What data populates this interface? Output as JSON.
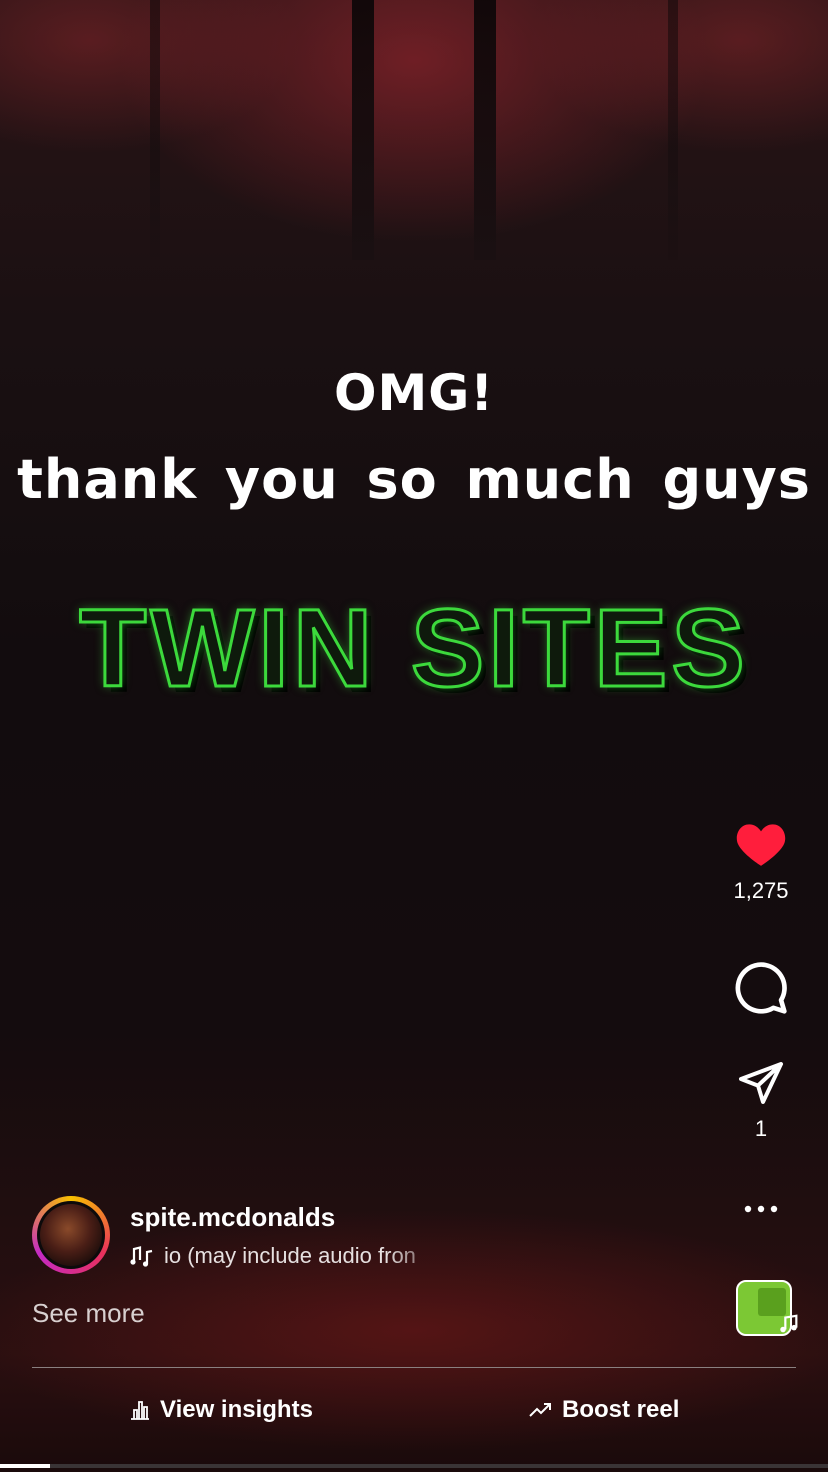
{
  "caption": {
    "line1": "OMG!",
    "line2": "thank you so much guys"
  },
  "title_graphic": "TWIN SITES",
  "actions": {
    "like_count": "1,275",
    "share_count": "1"
  },
  "author": {
    "username": "spite.mcdonalds",
    "audio_text": "io  (may include audio fron"
  },
  "see_more_label": "See more",
  "footer": {
    "insights_label": "View insights",
    "boost_label": "Boost reel"
  },
  "colors": {
    "like_red": "#ff1e3c",
    "title_green": "#3cd93c"
  },
  "icons": [
    "heart-icon",
    "comment-icon",
    "share-icon",
    "more-icon",
    "music-note-icon",
    "insights-icon",
    "trend-icon"
  ],
  "playback_progress": 0.06
}
